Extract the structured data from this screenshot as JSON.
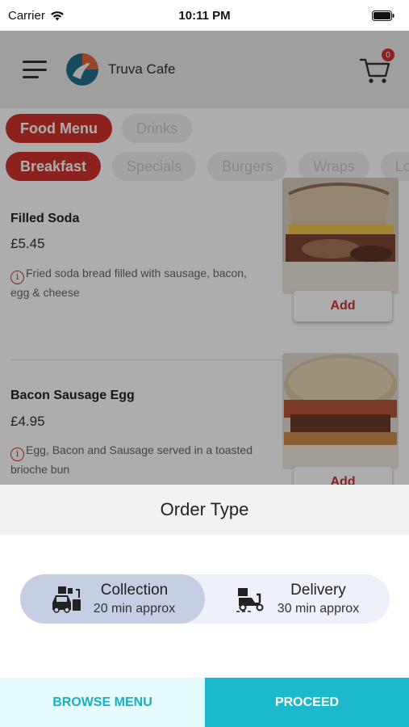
{
  "status_bar": {
    "carrier": "Carrier",
    "time": "10:11 PM"
  },
  "header": {
    "cafe_name": "Truva Cafe",
    "cart_count": "0"
  },
  "menu_tabs": [
    {
      "label": "Food Menu",
      "active": true
    },
    {
      "label": "Drinks",
      "active": false
    }
  ],
  "categories": [
    {
      "label": "Breakfast",
      "active": true
    },
    {
      "label": "Specials",
      "active": false
    },
    {
      "label": "Burgers",
      "active": false
    },
    {
      "label": "Wraps",
      "active": false
    },
    {
      "label": "Loa",
      "active": false
    }
  ],
  "items": [
    {
      "name": "Filled Soda",
      "price": "£5.45",
      "description": "Fried soda bread filled with sausage, bacon, egg & cheese",
      "add_label": "Add"
    },
    {
      "name": "Bacon Sausage Egg",
      "price": "£4.95",
      "description": "Egg, Bacon and Sausage served in a toasted brioche bun",
      "add_label": "Add"
    }
  ],
  "order_sheet": {
    "title": "Order Type",
    "options": [
      {
        "label": "Collection",
        "sub": "20 min approx",
        "icon": "collection-car-icon",
        "selected": true
      },
      {
        "label": "Delivery",
        "sub": "30 min approx",
        "icon": "delivery-scooter-icon",
        "selected": false
      }
    ]
  },
  "footer": {
    "browse_label": "BROWSE MENU",
    "proceed_label": "PROCEED"
  },
  "colors": {
    "accent_red": "#d0312d",
    "teal": "#1cb8cb",
    "selected_option": "#c5cee3"
  }
}
